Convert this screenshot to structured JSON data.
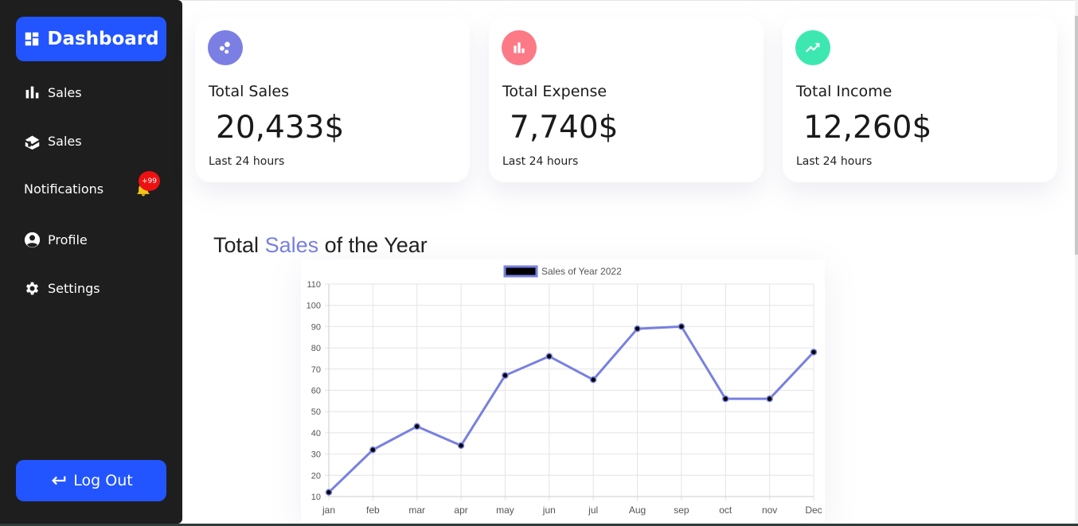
{
  "sidebar": {
    "brand_label": "Dashboard",
    "items": [
      {
        "label": "Sales",
        "icon": "bar-chart-icon"
      },
      {
        "label": "Sales",
        "icon": "box-icon"
      },
      {
        "label": "Notifications",
        "icon": "bell-icon",
        "badge": "+99"
      },
      {
        "label": "Profile",
        "icon": "user-circle-icon"
      },
      {
        "label": "Settings",
        "icon": "gear-icon"
      }
    ],
    "logout_label": "Log Out"
  },
  "cards": [
    {
      "title": "Total Sales",
      "value": "20,433$",
      "sub": "Last 24 hours",
      "icon": "bubbles-icon",
      "color": "#7b7fe3"
    },
    {
      "title": "Total Expense",
      "value": "7,740$",
      "sub": "Last 24 hours",
      "icon": "bar-chart-icon",
      "color": "#fb7a86"
    },
    {
      "title": "Total Income",
      "value": "12,260$",
      "sub": "Last 24 hours",
      "icon": "trending-up-icon",
      "color": "#3de8b0"
    }
  ],
  "section": {
    "title_before": "Total",
    "title_accent": "Sales",
    "title_after": "of the Year"
  },
  "colors": {
    "accent_blue": "#2255ff",
    "sidebar_bg": "#1e1e1e",
    "line_color": "#7880e0"
  },
  "chart_data": {
    "type": "line",
    "categories": [
      "jan",
      "feb",
      "mar",
      "apr",
      "may",
      "jun",
      "jul",
      "Aug",
      "sep",
      "oct",
      "nov",
      "Dec"
    ],
    "series": [
      {
        "name": "Sales of Year 2022",
        "values": [
          12,
          32,
          43,
          34,
          67,
          76,
          65,
          89,
          90,
          56,
          56,
          78
        ]
      }
    ],
    "ylim": [
      10,
      110
    ],
    "yticks": [
      10,
      20,
      30,
      40,
      50,
      60,
      70,
      80,
      90,
      100,
      110
    ],
    "grid": true,
    "legend": "top-center"
  }
}
